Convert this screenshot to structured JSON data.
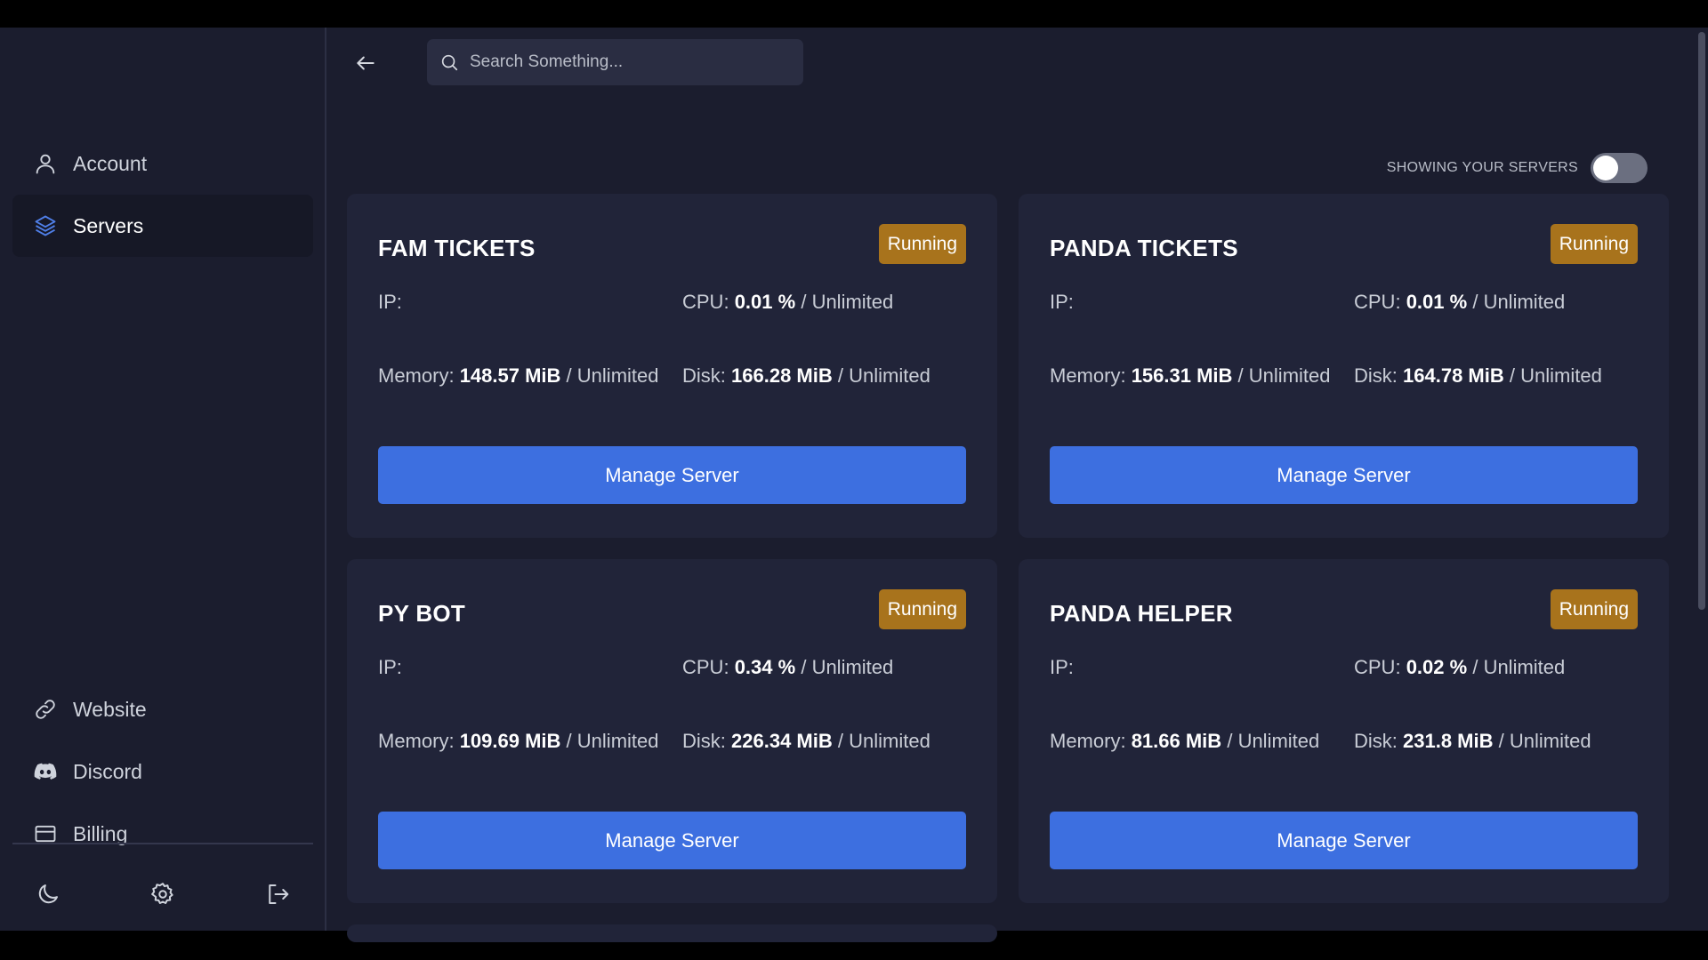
{
  "sidebar": {
    "nav": [
      {
        "label": "Account",
        "icon": "user-icon",
        "active": false
      },
      {
        "label": "Servers",
        "icon": "layers-icon",
        "active": true
      }
    ],
    "external": [
      {
        "label": "Website",
        "icon": "link-icon"
      },
      {
        "label": "Discord",
        "icon": "discord-icon"
      },
      {
        "label": "Billing",
        "icon": "credit-card-icon"
      }
    ],
    "bottom_icons": [
      "moon-icon",
      "gear-icon",
      "logout-icon"
    ]
  },
  "topbar": {
    "search_placeholder": "Search Something..."
  },
  "filter": {
    "label": "SHOWING YOUR SERVERS",
    "toggle_on": false
  },
  "colors": {
    "background": "#1b1d2e",
    "card": "#212439",
    "accent": "#3d6fe0",
    "status_running": "#a8731c"
  },
  "labels": {
    "ip": "IP:",
    "cpu": "CPU:",
    "memory": "Memory:",
    "disk": "Disk:",
    "unlimited": "Unlimited",
    "slash": "/"
  },
  "servers": [
    {
      "name": "FAM TICKETS",
      "status": "Running",
      "ip": "",
      "cpu": "0.01 %",
      "memory": "148.57 MiB",
      "disk": "166.28 MiB",
      "button": "Manage Server"
    },
    {
      "name": "PANDA TICKETS",
      "status": "Running",
      "ip": "",
      "cpu": "0.01 %",
      "memory": "156.31 MiB",
      "disk": "164.78 MiB",
      "button": "Manage Server"
    },
    {
      "name": "PY BOT",
      "status": "Running",
      "ip": "",
      "cpu": "0.34 %",
      "memory": "109.69 MiB",
      "disk": "226.34 MiB",
      "button": "Manage Server"
    },
    {
      "name": "PANDA HELPER",
      "status": "Running",
      "ip": "",
      "cpu": "0.02 %",
      "memory": "81.66 MiB",
      "disk": "231.8 MiB",
      "button": "Manage Server"
    }
  ]
}
